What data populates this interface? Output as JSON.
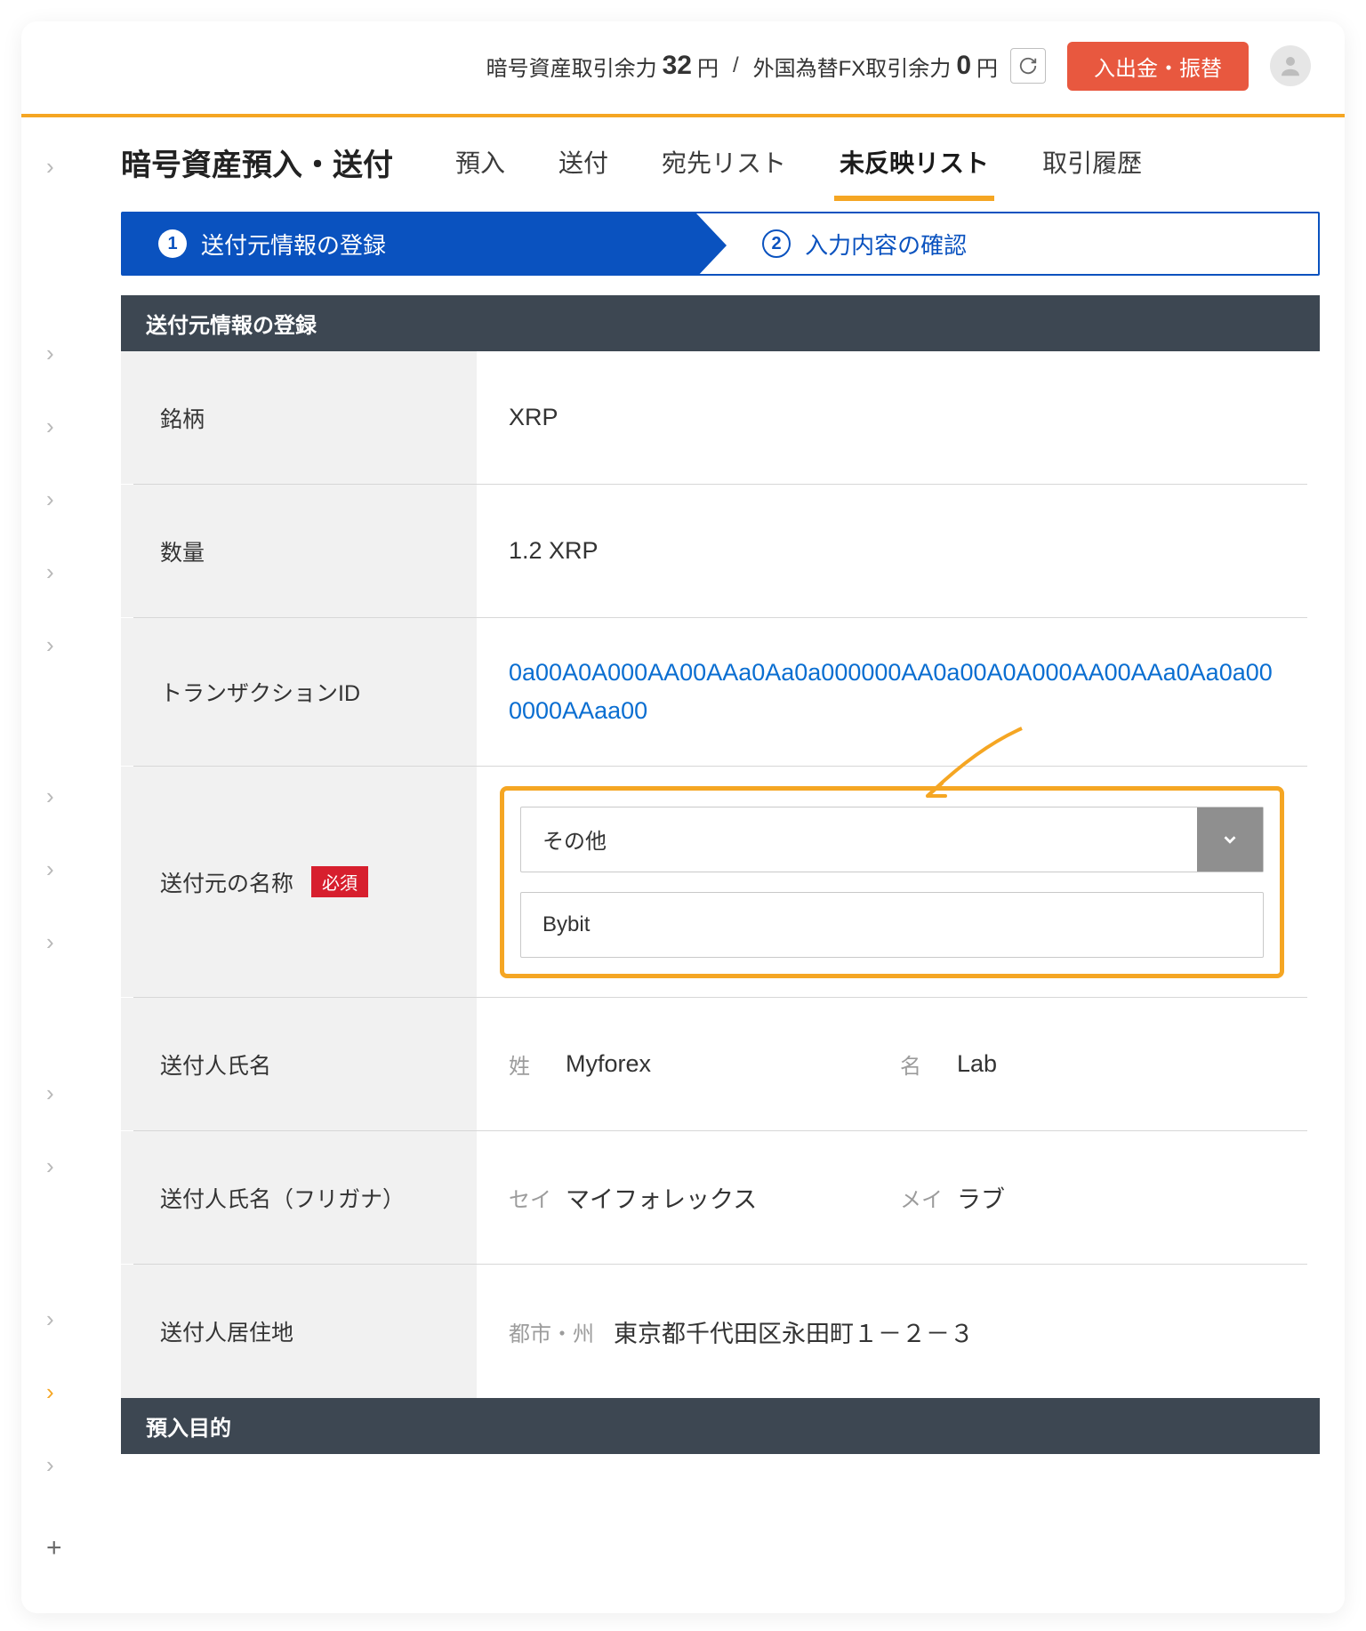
{
  "header": {
    "crypto_label": "暗号資産取引余力",
    "crypto_value": "32",
    "crypto_unit": "円",
    "fx_label": "外国為替FX取引余力",
    "fx_value": "0",
    "fx_unit": "円",
    "deposit_btn": "入出金・振替"
  },
  "page": {
    "title": "暗号資産預入・送付",
    "tabs": {
      "deposit": "預入",
      "send": "送付",
      "dest": "宛先リスト",
      "pending": "未反映リスト",
      "history": "取引履歴"
    }
  },
  "steps": {
    "s1": "送付元情報の登録",
    "s2": "入力内容の確認"
  },
  "section1": "送付元情報の登録",
  "section2": "預入目的",
  "form": {
    "symbol_label": "銘柄",
    "symbol_value": "XRP",
    "qty_label": "数量",
    "qty_value": "1.2 XRP",
    "txid_label": "トランザクションID",
    "txid_value": "0a00A0A000AA00AAa0Aa0a000000AA0a00A0A000AA00AAa0Aa0a000000AAaa00",
    "sender_name_label": "送付元の名称",
    "required": "必須",
    "sender_select": "その他",
    "sender_input": "Bybit",
    "person_name_label": "送付人氏名",
    "sei_label": "姓",
    "sei_value": "Myforex",
    "mei_label": "名",
    "mei_value": "Lab",
    "kana_label": "送付人氏名（フリガナ）",
    "sei_k_label": "セイ",
    "sei_k_value": "マイフォレックス",
    "mei_k_label": "メイ",
    "mei_k_value": "ラブ",
    "addr_label": "送付人居住地",
    "city_label": "都市・州",
    "addr_value": "東京都千代田区永田町１－２－３"
  }
}
